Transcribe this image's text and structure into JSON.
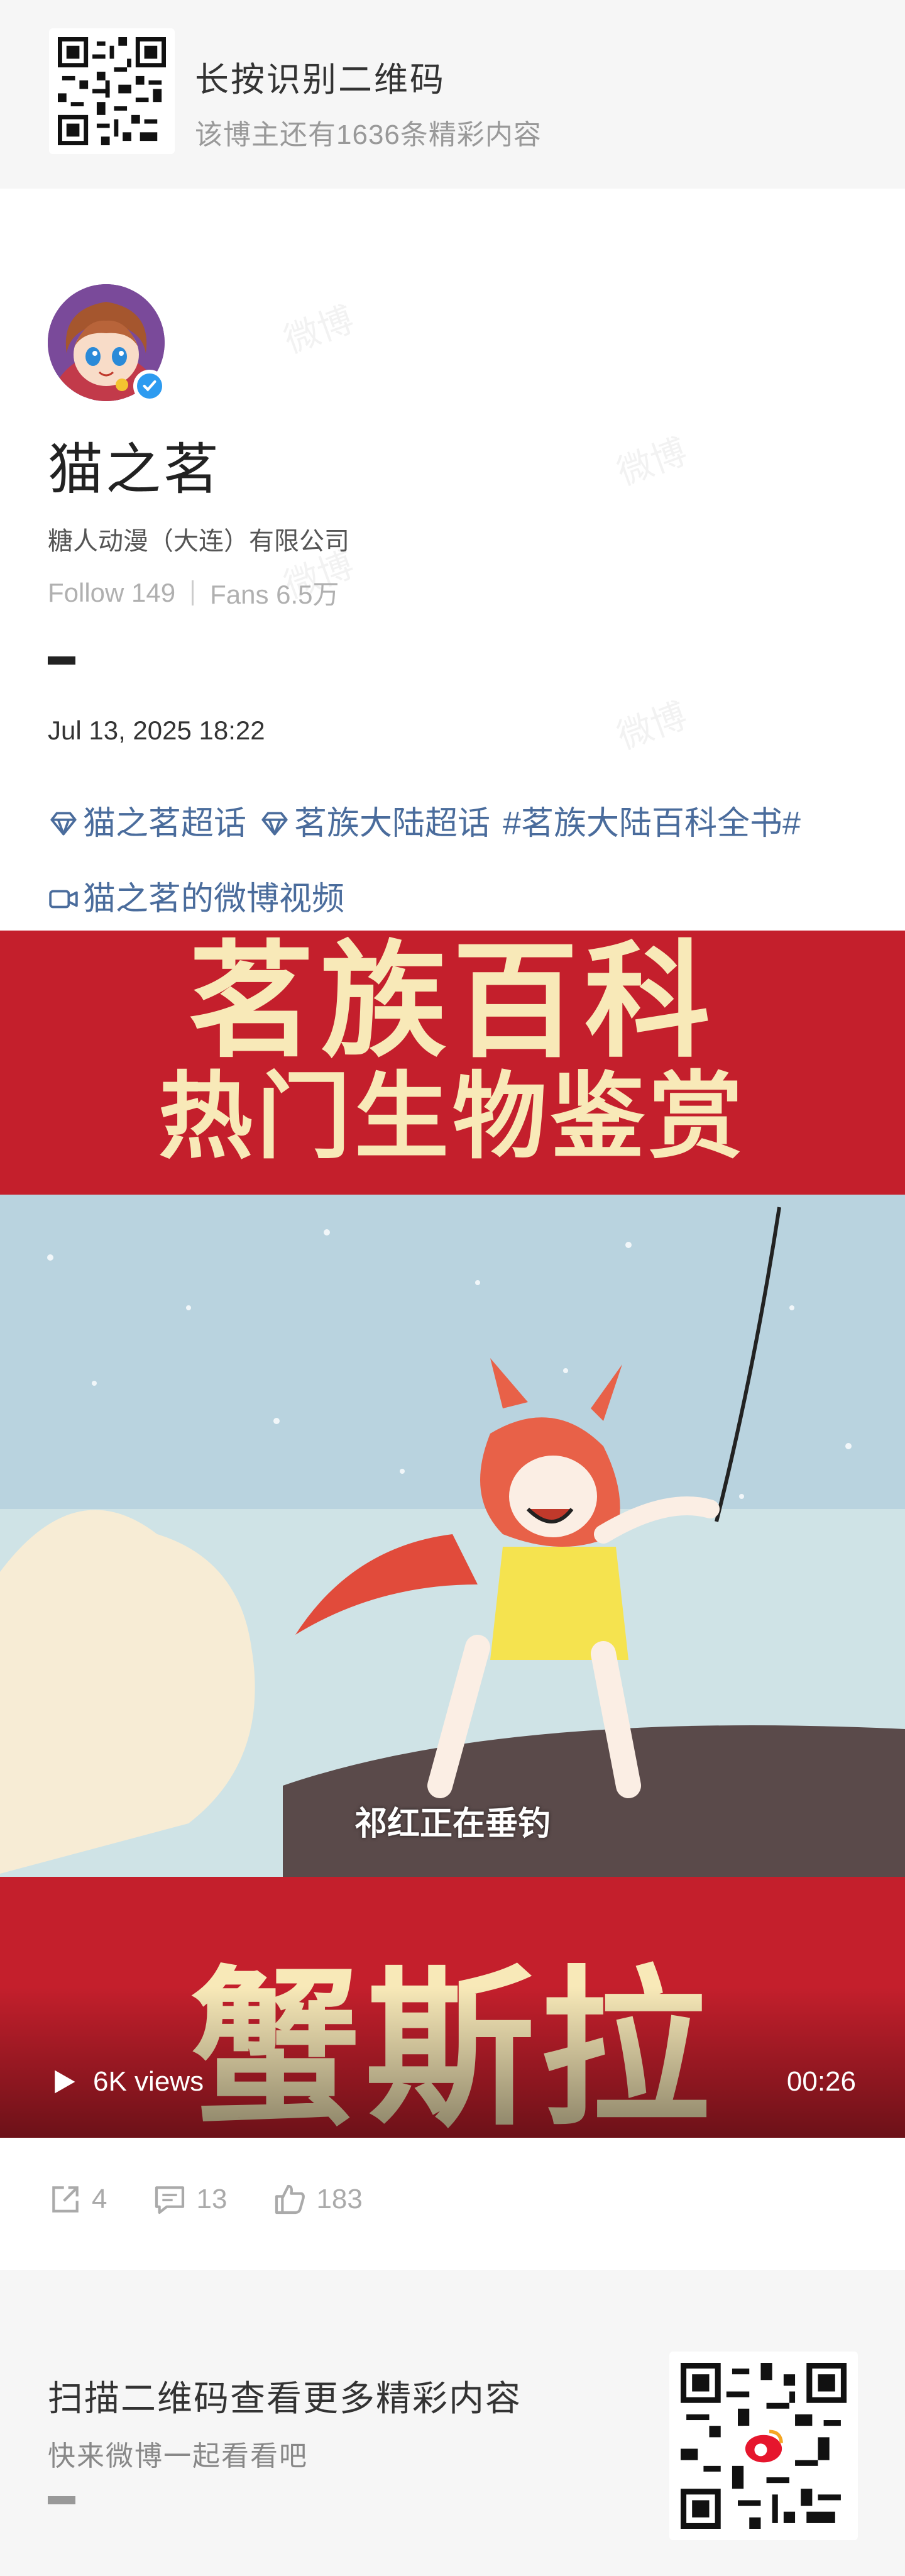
{
  "header": {
    "title": "长按识别二维码",
    "subtitle": "该博主还有1636条精彩内容"
  },
  "profile": {
    "name": "猫之茗",
    "company": "糖人动漫（大连）有限公司",
    "follow": "Follow 149",
    "fans": "Fans 6.5万"
  },
  "post": {
    "time": "Jul 13, 2025 18:22",
    "tags_row1": [
      "猫之茗超话",
      "茗族大陆超话",
      "#茗族大陆百科全书#"
    ],
    "tags_row2": [
      "猫之茗的微博视频"
    ]
  },
  "video": {
    "caption_top1": "茗族百科",
    "caption_top2": "热门生物鉴赏",
    "subtitle": "祁红正在垂钓",
    "caption_bottom": "蟹斯拉",
    "views": "6K views",
    "duration": "00:26"
  },
  "actions": {
    "repost": "4",
    "comment": "13",
    "like": "183"
  },
  "footer": {
    "title": "扫描二维码查看更多精彩内容",
    "subtitle": "快来微博一起看看吧"
  },
  "watermark": "微博",
  "colors": {
    "tag": "#4a6c9c",
    "video_red": "#c41f2c",
    "caption_cream": "#f8e9b8",
    "verify": "#2d9bf0"
  }
}
